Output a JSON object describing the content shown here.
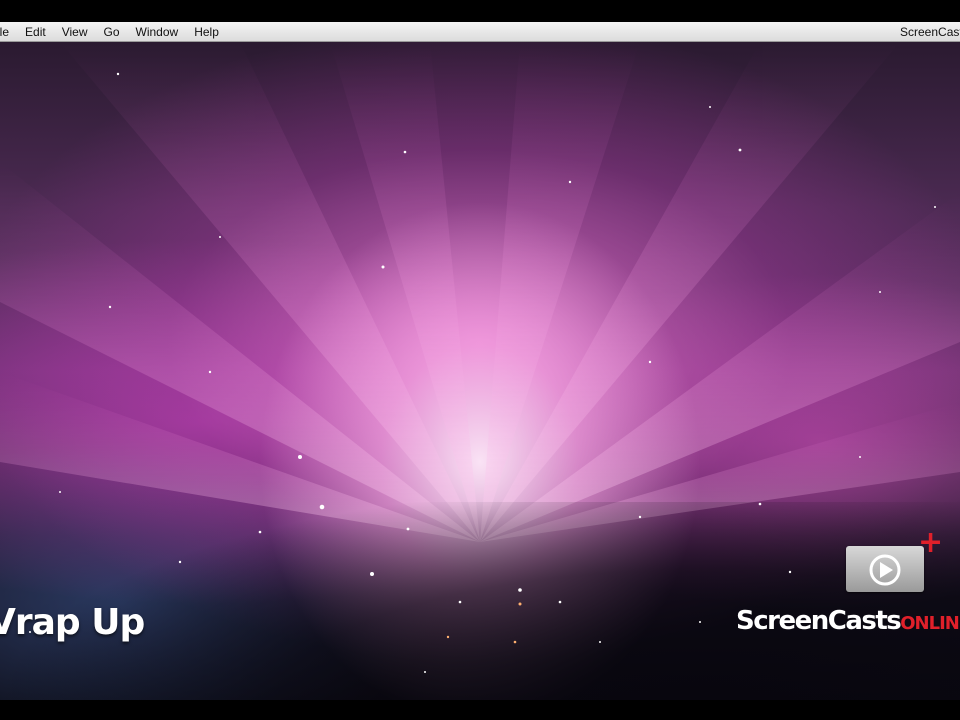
{
  "menubar": {
    "items": [
      "ile",
      "Edit",
      "View",
      "Go",
      "Window",
      "Help"
    ],
    "right_text": "ScreenCasts"
  },
  "overlay": {
    "caption": "Vrap Up"
  },
  "logo": {
    "brand_main": "ScreenCasts",
    "brand_accent": "ONLINE",
    "accent_color": "#e0202a",
    "play_icon": "play-icon",
    "plus_icon": "plus-icon"
  }
}
